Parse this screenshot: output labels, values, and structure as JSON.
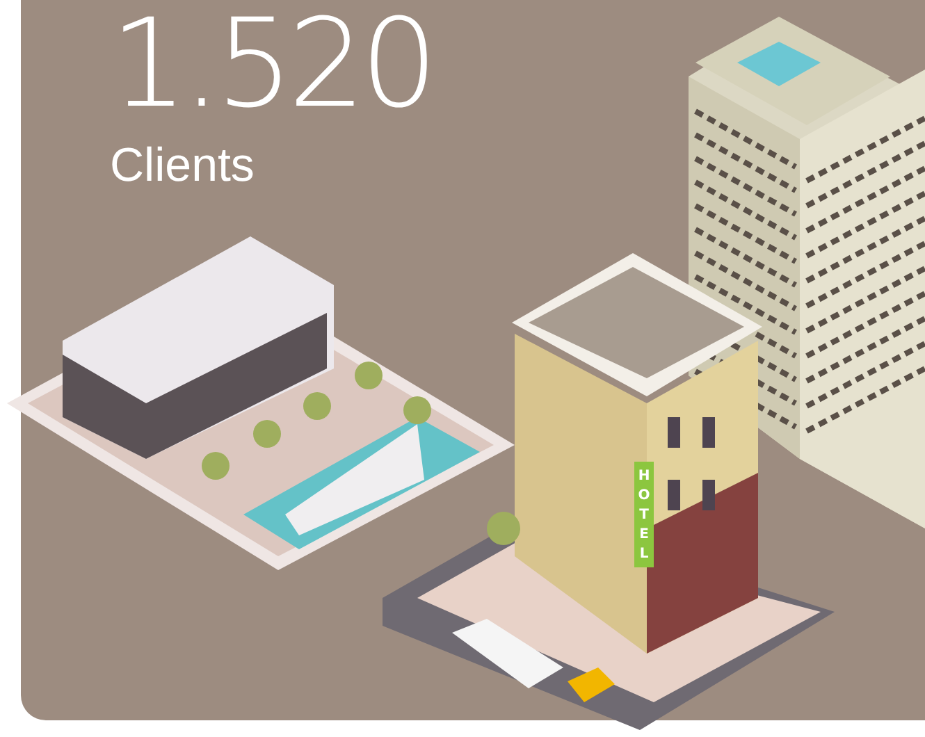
{
  "stat": {
    "value": "1.520",
    "label": "Clients"
  },
  "illustration": {
    "sign": "HOTEL"
  }
}
